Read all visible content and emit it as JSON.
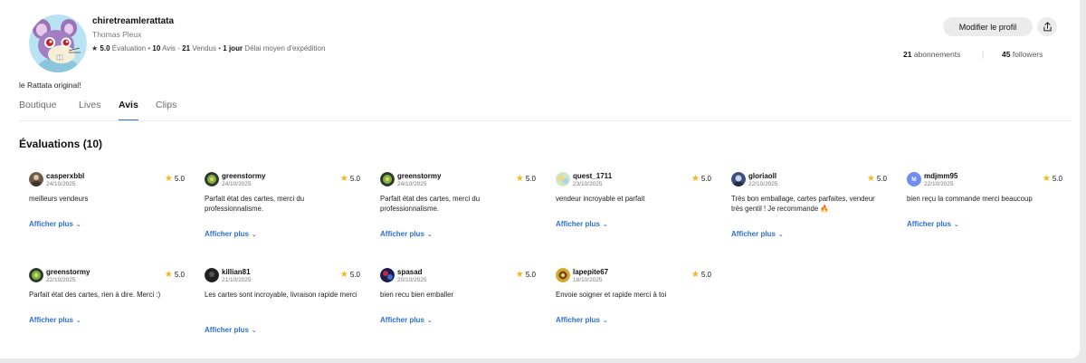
{
  "profile": {
    "username": "chiretreamlerattata",
    "real_name": "Thomas Pleux",
    "rating_value": "5.0",
    "rating_label": "Évaluation",
    "reviews_count": "10",
    "reviews_label": "Avis",
    "sold_count": "21",
    "sold_label": "Vendus",
    "ship_time": "1 jour",
    "ship_label": "Délai moyen d'expédition",
    "bio": "le Rattata original!",
    "edit_button": "Modifier le profil",
    "subscriptions_count": "21",
    "subscriptions_label": "abonnements",
    "followers_count": "45",
    "followers_label": "followers"
  },
  "tabs": [
    {
      "label": "Boutique"
    },
    {
      "label": "Lives"
    },
    {
      "label": "Avis"
    },
    {
      "label": "Clips"
    }
  ],
  "section": {
    "title": "Évaluations (10)"
  },
  "more_label": "Afficher plus",
  "reviews": [
    {
      "user": "casperxbbl",
      "date": "24/10/2025",
      "rating": "5.0",
      "text": "meilleurs vendeurs"
    },
    {
      "user": "greenstormy",
      "date": "24/10/2025",
      "rating": "5.0",
      "text": "Parfait état des cartes, merci du professionnalisme."
    },
    {
      "user": "greenstormy",
      "date": "24/10/2025",
      "rating": "5.0",
      "text": "Parfait état des cartes, merci du professionnalisme."
    },
    {
      "user": "quest_1711",
      "date": "23/10/2025",
      "rating": "5.0",
      "text": "vendeur incroyable et parfait"
    },
    {
      "user": "gloriaoll",
      "date": "22/10/2025",
      "rating": "5.0",
      "text": "Très bon emballage, cartes parfaites, vendeur très gentil ! Je recommande 🔥"
    },
    {
      "user": "mdjmm95",
      "date": "22/10/2025",
      "rating": "5.0",
      "text": "bien reçu la commande merci beaucoup",
      "avatar_letter": "M"
    },
    {
      "user": "greenstormy",
      "date": "22/10/2025",
      "rating": "5.0",
      "text": "Parfait état des cartes, rien à dire. Merci :)"
    },
    {
      "user": "killian81",
      "date": "21/10/2025",
      "rating": "5.0",
      "text": "Les cartes sont incroyable, livraison rapide merci"
    },
    {
      "user": "spasad",
      "date": "20/10/2025",
      "rating": "5.0",
      "text": "bien recu bien emballer"
    },
    {
      "user": "lapepite67",
      "date": "18/10/2025",
      "rating": "5.0",
      "text": "Envoie soigner et rapide merci à toi"
    }
  ],
  "colors": {
    "accent": "#2d6fd8",
    "star": "#f2b619"
  }
}
